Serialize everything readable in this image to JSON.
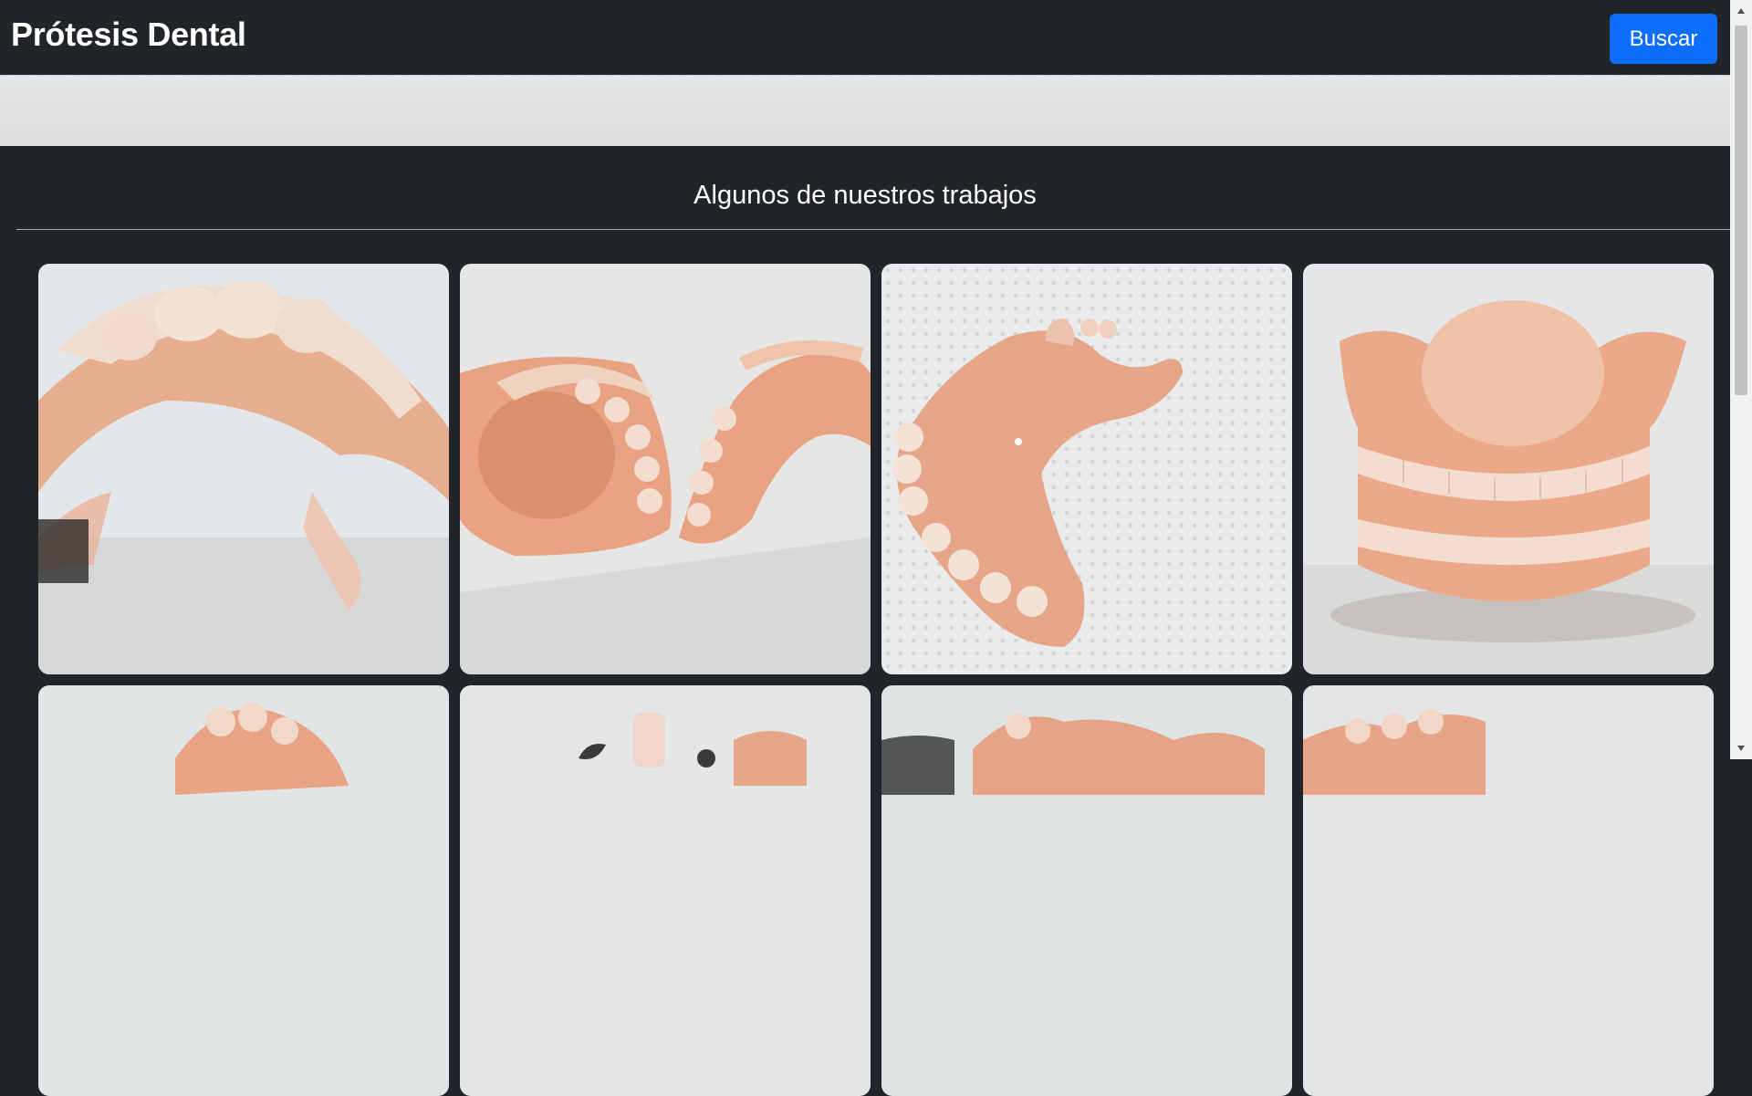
{
  "navbar": {
    "brand": "Prótesis Dental",
    "search_label": "Buscar"
  },
  "section": {
    "title": "Algunos de nuestros trabajos"
  },
  "gallery": {
    "items": [
      {
        "alt": "Prótesis parcial superior vista lateral"
      },
      {
        "alt": "Prótesis parcial acrílica sobre mesa"
      },
      {
        "alt": "Prótesis parcial sobre servilleta"
      },
      {
        "alt": "Prótesis completa superior e inferior"
      },
      {
        "alt": "Prótesis parcial"
      },
      {
        "alt": "Prótesis con ganchos metálicos"
      },
      {
        "alt": "Prótesis parcial"
      },
      {
        "alt": "Prótesis parcial"
      }
    ]
  },
  "colors": {
    "background": "#212529",
    "accent": "#0d6efd",
    "gum_pink": "#e9a487",
    "tooth": "#f1ddd0"
  }
}
